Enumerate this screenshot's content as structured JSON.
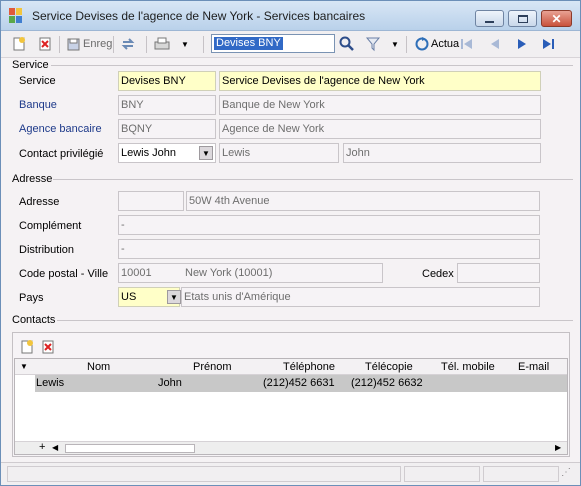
{
  "window": {
    "title": "Service Devises de l'agence de New York  -  Services bancaires"
  },
  "toolbar": {
    "save_label": "Enreg",
    "search_value": "Devises BNY",
    "refresh_label": "Actua"
  },
  "service_section": {
    "title": "Service",
    "service_label": "Service",
    "service_code": "Devises BNY",
    "service_name": "Service Devises de l'agence de New York",
    "bank_label": "Banque",
    "bank_code": "BNY",
    "bank_name": "Banque de New York",
    "agency_label": "Agence bancaire",
    "agency_code": "BQNY",
    "agency_name": "Agence de New York",
    "contact_label": "Contact privilégié",
    "contact_value": "Lewis John",
    "contact_last": "Lewis",
    "contact_first": "John"
  },
  "address_section": {
    "title": "Adresse",
    "address_label": "Adresse",
    "address_value": "50W 4th Avenue",
    "complement_label": "Complément",
    "complement_value": "-",
    "distribution_label": "Distribution",
    "distribution_value": "-",
    "postal_label": "Code postal - Ville",
    "postal_code": "10001",
    "city": "New York (10001)",
    "cedex_label": "Cedex",
    "country_label": "Pays",
    "country_code": "US",
    "country_name": "Etats unis d'Amérique"
  },
  "contacts_section": {
    "title": "Contacts",
    "columns": [
      "Nom",
      "Prénom",
      "Téléphone",
      "Télécopie",
      "Tél. mobile",
      "E-mail"
    ],
    "rows": [
      {
        "nom": "Lewis",
        "prenom": "John",
        "telephone": "(212)452 6631",
        "telecopie": "(212)452 6632",
        "mobile": "",
        "email": ""
      }
    ]
  },
  "colors": {
    "accent": "#3169c6",
    "highlight_field": "#ffffc8",
    "link_label": "#1e3a8a"
  }
}
